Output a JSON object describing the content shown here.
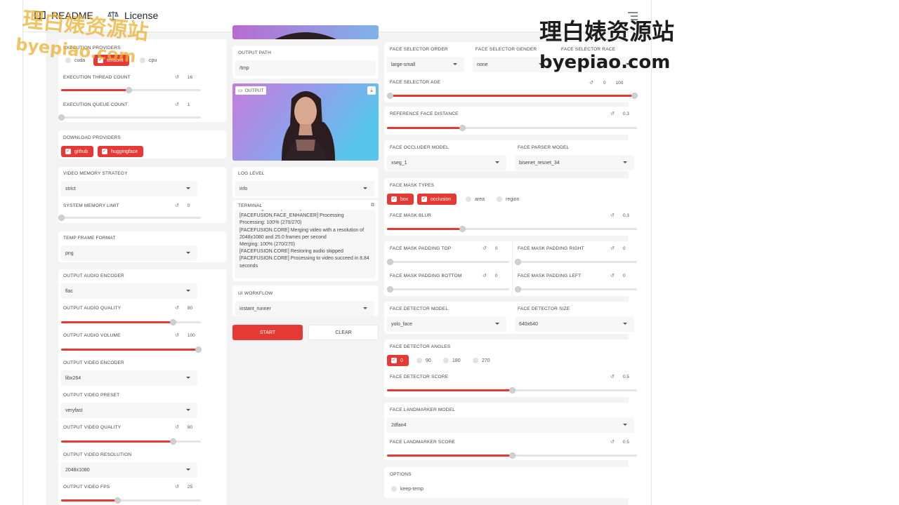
{
  "github": {
    "tabs": [
      {
        "label": "README",
        "icon": "book-icon"
      },
      {
        "label": "License",
        "icon": "scale-icon"
      }
    ]
  },
  "left": {
    "execution_providers": {
      "label": "EXECUTION PROVIDERS",
      "options": [
        "cuda",
        "tensorrt",
        "cpu"
      ]
    },
    "thread_count": {
      "label": "EXECUTION THREAD COUNT",
      "value": "16",
      "fraction": 0.48
    },
    "queue_count": {
      "label": "EXECUTION QUEUE COUNT",
      "value": "1",
      "fraction": 0.0
    },
    "download_providers": {
      "label": "DOWNLOAD PROVIDERS",
      "options": [
        "github",
        "huggingface"
      ]
    },
    "video_memory_strategy": {
      "label": "VIDEO MEMORY STRATEGY",
      "value": "strict"
    },
    "system_memory_limit": {
      "label": "SYSTEM MEMORY LIMIT",
      "value": "0",
      "fraction": 0.0
    },
    "temp_frame_format": {
      "label": "TEMP FRAME FORMAT",
      "value": "png"
    },
    "audio_encoder": {
      "label": "OUTPUT AUDIO ENCODER",
      "value": "flac"
    },
    "audio_quality": {
      "label": "OUTPUT AUDIO QUALITY",
      "value": "80",
      "fraction": 0.8
    },
    "audio_volume": {
      "label": "OUTPUT AUDIO VOLUME",
      "value": "100",
      "fraction": 1.0
    },
    "video_encoder": {
      "label": "OUTPUT VIDEO ENCODER",
      "value": "libx264"
    },
    "video_preset": {
      "label": "OUTPUT VIDEO PRESET",
      "value": "veryfast"
    },
    "video_quality": {
      "label": "OUTPUT VIDEO QUALITY",
      "value": "80",
      "fraction": 0.8
    },
    "video_resolution": {
      "label": "OUTPUT VIDEO RESOLUTION",
      "value": "2048x1080"
    },
    "video_fps": {
      "label": "OUTPUT VIDEO FPS",
      "value": "25",
      "fraction": 0.4
    }
  },
  "middle": {
    "output_path": {
      "label": "OUTPUT PATH",
      "value": "/tmp"
    },
    "output_badge": "OUTPUT",
    "log_level": {
      "label": "LOG LEVEL",
      "value": "info"
    },
    "terminal": {
      "label": "TERMINAL",
      "text": "Processing: 100% (270/270)\n[FACEFUSION.FACE_ENHANCER] Processing\nProcessing: 100% (270/270)\n[FACEFUSION.CORE] Merging video with a resolution of 2048x1080 and 25.0 frames per second\nMerging: 100% (270/270)\n[FACEFUSION.CORE] Restoring audio skipped\n[FACEFUSION.CORE] Processing to video succeed in 8.84 seconds"
    },
    "ui_workflow": {
      "label": "UI WORKFLOW",
      "value": "instant_runner"
    },
    "start_label": "START",
    "clear_label": "CLEAR"
  },
  "right": {
    "selector_order": {
      "label": "FACE SELECTOR ORDER",
      "value": "large-small"
    },
    "selector_gender": {
      "label": "FACE SELECTOR GENDER",
      "value": "none"
    },
    "selector_race": {
      "label": "FACE SELECTOR RACE"
    },
    "selector_age": {
      "label": "FACE SELECTOR AGE",
      "min": "0",
      "max": "100"
    },
    "ref_distance": {
      "label": "REFERENCE FACE DISTANCE",
      "value": "0.3",
      "fraction": 0.3
    },
    "occluder_model": {
      "label": "FACE OCCLUDER MODEL",
      "value": "xseg_1"
    },
    "parser_model": {
      "label": "FACE PARSER MODEL",
      "value": "bisenet_resnet_34"
    },
    "mask_types": {
      "label": "FACE MASK TYPES",
      "options": [
        "box",
        "occlusion",
        "area",
        "region"
      ]
    },
    "mask_blur": {
      "label": "FACE MASK BLUR",
      "value": "0.3",
      "fraction": 0.3
    },
    "pad_top": {
      "label": "FACE MASK PADDING TOP",
      "value": "0"
    },
    "pad_right": {
      "label": "FACE MASK PADDING RIGHT",
      "value": "0"
    },
    "pad_bottom": {
      "label": "FACE MASK PADDING BOTTOM",
      "value": "0"
    },
    "pad_left": {
      "label": "FACE MASK PADDING LEFT",
      "value": "0"
    },
    "detector_model": {
      "label": "FACE DETECTOR MODEL",
      "value": "yolo_face"
    },
    "detector_size": {
      "label": "FACE DETECTOR SIZE",
      "value": "640x640"
    },
    "detector_angles": {
      "label": "FACE DETECTOR ANGLES",
      "options": [
        "0",
        "90",
        "180",
        "270"
      ]
    },
    "detector_score": {
      "label": "FACE DETECTOR SCORE",
      "value": "0.5",
      "fraction": 0.5
    },
    "landmarker_model": {
      "label": "FACE LANDMARKER MODEL",
      "value": "2dfan4"
    },
    "landmarker_score": {
      "label": "FACE LANDMARKER SCORE",
      "value": "0.5",
      "fraction": 0.5
    },
    "options": {
      "label": "OPTIONS",
      "value": "keep-temp"
    }
  },
  "watermark": {
    "cn": "理白婊资源站",
    "en": "byepiao.com"
  },
  "colors": {
    "accent": "#e53935",
    "panel_bg": "#f3f3f3",
    "track": "#e5e5e5"
  }
}
